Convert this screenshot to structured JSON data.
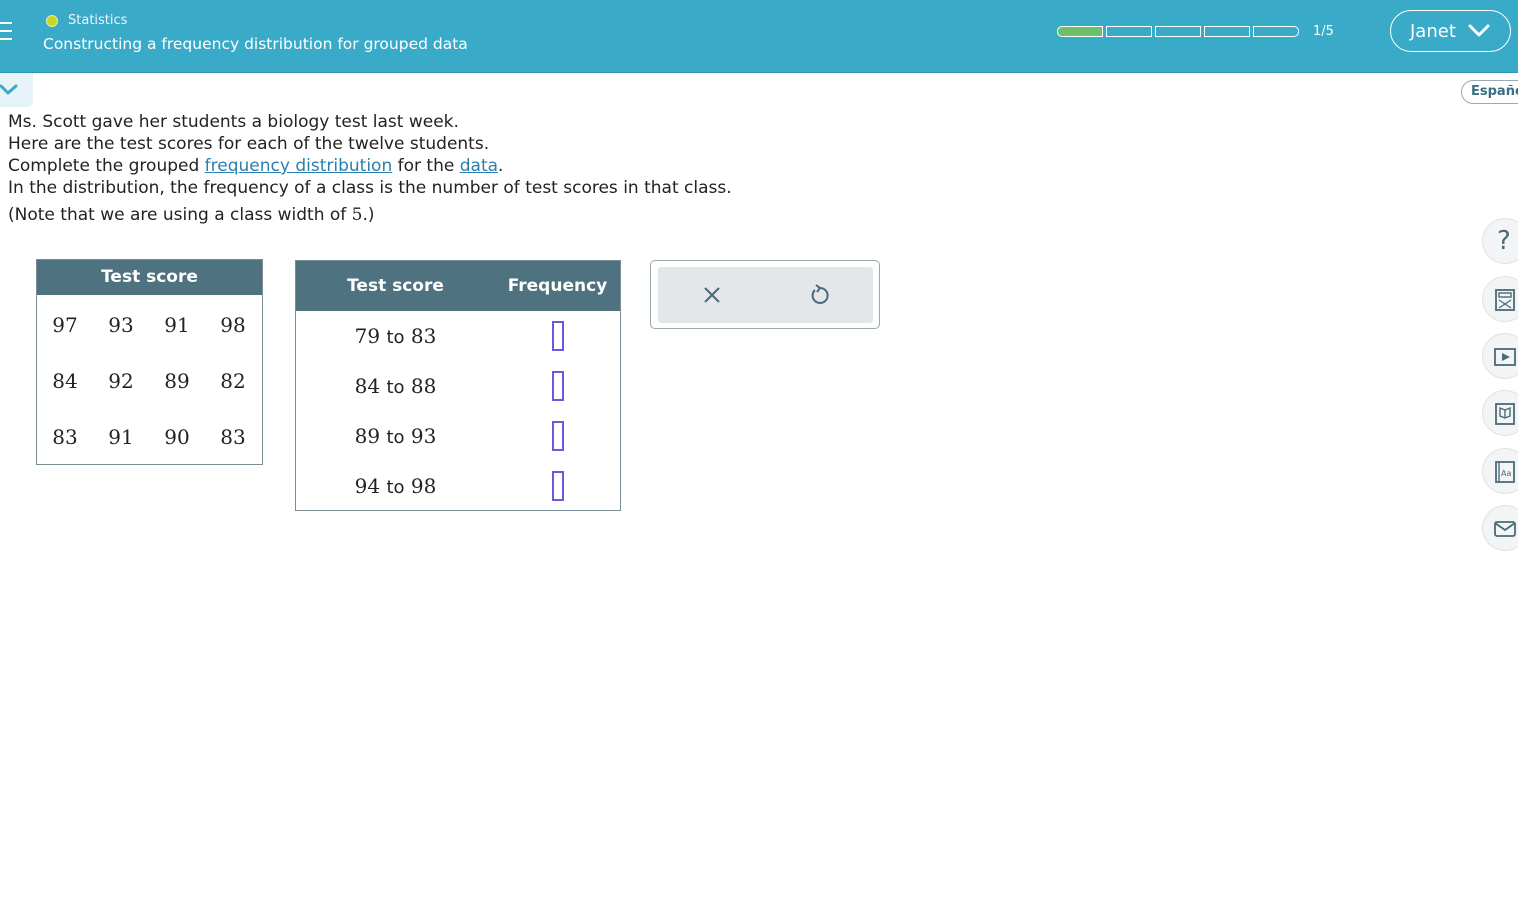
{
  "header": {
    "topic": "Statistics",
    "lesson_title": "Constructing a frequency distribution for grouped data",
    "progress": {
      "current": 1,
      "total": 5,
      "label": "1/5"
    },
    "user_name": "Janet"
  },
  "language_button": "Españo",
  "problem": {
    "line1": "Ms. Scott gave her students a biology test last week.",
    "line2": "Here are the test scores for each of the twelve students.",
    "line3_before": "Complete the grouped ",
    "line3_link1": "frequency distribution",
    "line3_mid": " for the ",
    "line3_link2": "data",
    "line3_after": ".",
    "line4": "In the distribution, the frequency of a class is the number of test scores in that class.",
    "note_before": "(Note that we are using a class width of ",
    "note_value": "5",
    "note_after": ".)"
  },
  "scores_table": {
    "header": "Test score",
    "rows": [
      [
        "97",
        "93",
        "91",
        "98"
      ],
      [
        "84",
        "92",
        "89",
        "82"
      ],
      [
        "83",
        "91",
        "90",
        "83"
      ]
    ]
  },
  "frequency_table": {
    "col1_header": "Test score",
    "col2_header": "Frequency",
    "to_word": "to",
    "classes": [
      {
        "low": "79",
        "high": "83",
        "frequency": ""
      },
      {
        "low": "84",
        "high": "88",
        "frequency": ""
      },
      {
        "low": "89",
        "high": "93",
        "frequency": ""
      },
      {
        "low": "94",
        "high": "98",
        "frequency": ""
      }
    ]
  },
  "tools": {
    "clear_icon": "close-icon",
    "undo_icon": "undo-icon"
  },
  "sidebar": {
    "help_glyph": "?",
    "icons": [
      "help-icon",
      "calculator-icon",
      "video-icon",
      "ebook-icon",
      "glossary-icon",
      "message-icon"
    ],
    "glossary_text": "Aa"
  },
  "colors": {
    "header_bg": "#3aaac9",
    "table_header_bg": "#4f7280",
    "progress_filled": "#6cc06a",
    "input_border": "#6a5ae0",
    "link": "#2a7fb0"
  }
}
